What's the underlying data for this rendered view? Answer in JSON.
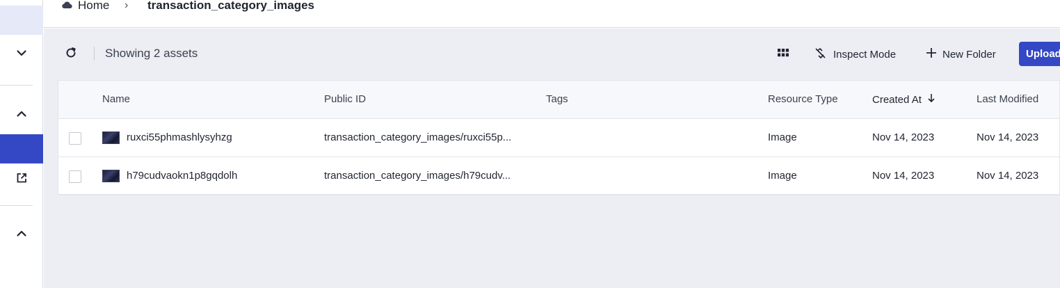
{
  "breadcrumb": {
    "home_label": "Home",
    "separator": "›",
    "current": "transaction_category_images"
  },
  "toolbar": {
    "showing_label": "Showing 2 assets",
    "inspect_label": "Inspect Mode",
    "new_folder_label": "New Folder",
    "upload_label": "Upload"
  },
  "table": {
    "columns": {
      "name": "Name",
      "public_id": "Public ID",
      "tags": "Tags",
      "resource_type": "Resource Type",
      "created_at": "Created At",
      "last_modified": "Last Modified"
    },
    "rows": [
      {
        "name": "ruxci55phmashlysyhzg",
        "public_id": "transaction_category_images/ruxci55p...",
        "tags": "",
        "resource_type": "Image",
        "created_at": "Nov 14, 2023",
        "last_modified": "Nov 14, 2023"
      },
      {
        "name": "h79cudvaokn1p8gqdolh",
        "public_id": "transaction_category_images/h79cudv...",
        "tags": "",
        "resource_type": "Image",
        "created_at": "Nov 14, 2023",
        "last_modified": "Nov 14, 2023"
      }
    ]
  },
  "colors": {
    "accent": "#3448c5",
    "main_background": "#eceef4",
    "sidebar_highlight": "#e6e9f7"
  },
  "icons": {
    "home": "cloud-icon",
    "refresh": "refresh-icon",
    "grid_view": "grid-view-icon",
    "inspect": "inspect-mode-icon",
    "new_folder": "plus-icon",
    "sort": "arrow-down-icon",
    "sidebar": [
      "chevron-down-icon",
      "chevron-up-icon",
      "external-link-icon",
      "chevron-up-icon"
    ]
  }
}
